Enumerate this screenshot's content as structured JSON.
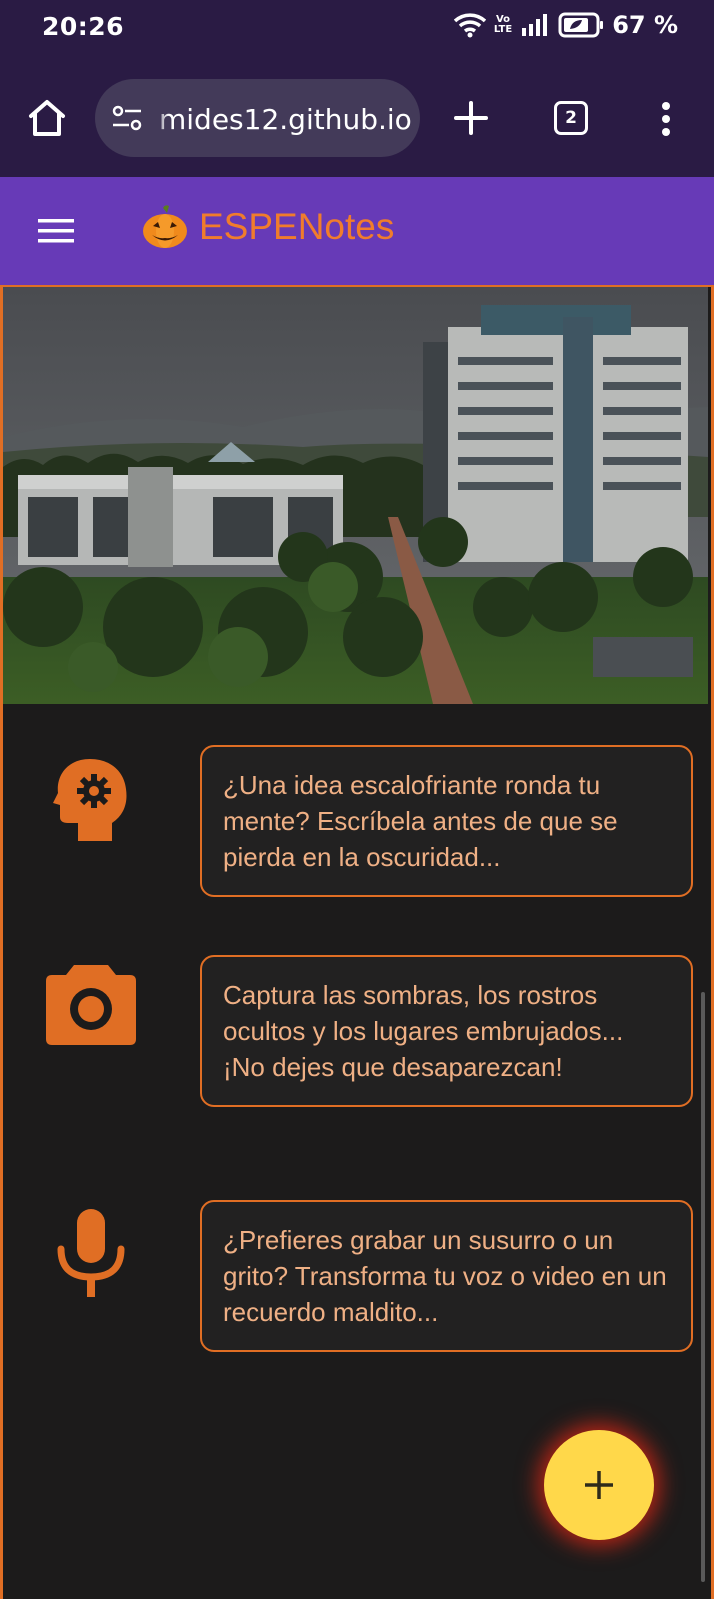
{
  "status_bar": {
    "time": "20:26",
    "network_label_top": "Vo",
    "network_label_bottom": "LTE",
    "battery_percent": "67 %",
    "icons": [
      "wifi-icon",
      "signal-icon",
      "battery-icon"
    ]
  },
  "browser": {
    "url": "mides12.github.io",
    "tab_count": "2",
    "icons": [
      "home-icon",
      "site-settings-icon",
      "plus-icon",
      "more-vert-icon"
    ]
  },
  "app": {
    "title": "ESPENotes",
    "title_color": "#f07c2c",
    "header_color": "#673ab7",
    "accent_color": "#e06e24",
    "icons": [
      "menu-icon",
      "pumpkin-icon"
    ]
  },
  "features": [
    {
      "icon": "idea-head-icon",
      "text": "¿Una idea escalofriante ronda tu mente? Escríbela antes de que se pierda en la oscuridad..."
    },
    {
      "icon": "camera-icon",
      "text": "Captura las sombras, los rostros ocultos y los lugares embrujados... ¡No dejes que desaparezcan!"
    },
    {
      "icon": "microphone-icon",
      "text": "¿Prefieres grabar un susurro o un grito? Transforma tu voz o video en un recuerdo maldito..."
    }
  ],
  "fab": {
    "icon": "plus-icon",
    "color": "#ffd84a"
  }
}
